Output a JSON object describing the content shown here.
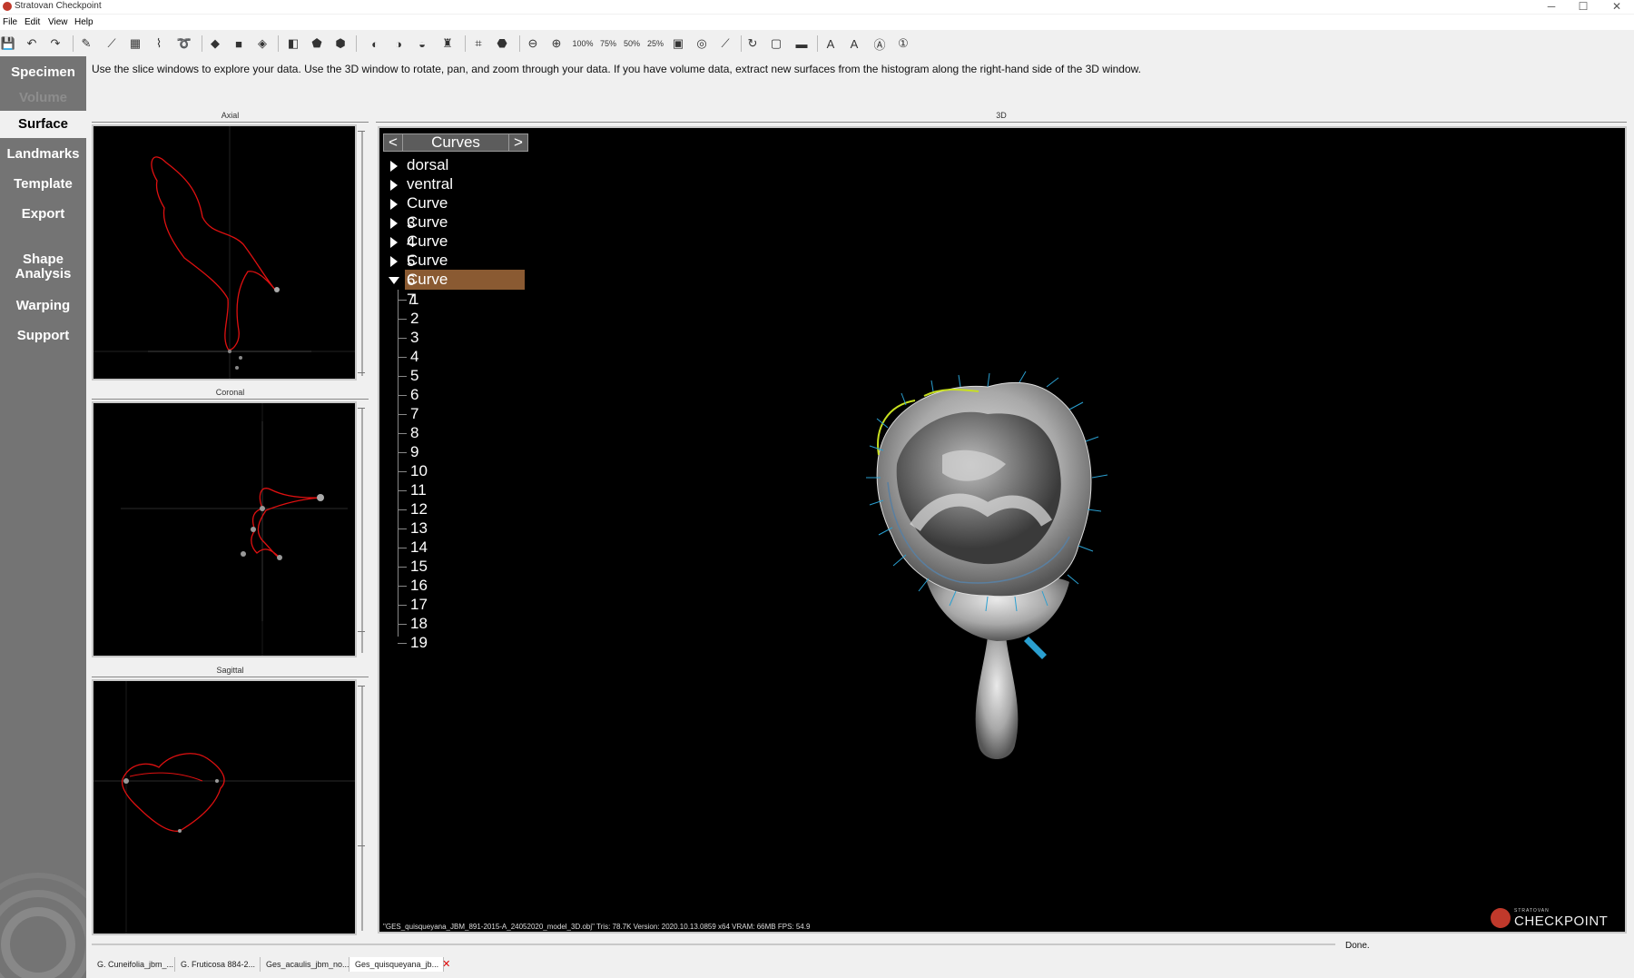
{
  "window": {
    "title": "Stratovan Checkpoint",
    "controls": [
      "─",
      "☐",
      "✕"
    ]
  },
  "menu": [
    "File",
    "Edit",
    "View",
    "Help"
  ],
  "toolbar": {
    "zoom_levels": [
      "100%",
      "75%",
      "50%",
      "25%"
    ]
  },
  "sidebar": {
    "items": [
      {
        "label": "Specimen",
        "state": "normal"
      },
      {
        "label": "Volume",
        "state": "disabled"
      },
      {
        "label": "Surface",
        "state": "active"
      },
      {
        "label": "Landmarks",
        "state": "normal"
      },
      {
        "label": "Template",
        "state": "normal"
      },
      {
        "label": "Export",
        "state": "normal"
      },
      {
        "label": "Shape\nAnalysis",
        "state": "normal"
      },
      {
        "label": "Warping",
        "state": "normal"
      },
      {
        "label": "Support",
        "state": "normal"
      }
    ]
  },
  "instruction": "Use the slice windows to explore your data. Use the 3D window to rotate, pan, and zoom through your data. If you have volume data, extract new surfaces from the histogram along the right-hand side of the 3D window.",
  "slices": {
    "axial": "Axial",
    "coronal": "Coronal",
    "sagittal": "Sagittal"
  },
  "view3d": {
    "title": "3D",
    "curves_header": "Curves",
    "prev": "<",
    "next": ">",
    "curves": [
      "dorsal",
      "ventral",
      "Curve 3",
      "Curve 4",
      "Curve 5",
      "Curve 6",
      "Curve 7"
    ],
    "expanded_curve": "Curve 7",
    "points": [
      "1",
      "2",
      "3",
      "4",
      "5",
      "6",
      "7",
      "8",
      "9",
      "10",
      "11",
      "12",
      "13",
      "14",
      "15",
      "16",
      "17",
      "18",
      "19"
    ],
    "status": "\"GES_quisqueyana_JBM_891-2015-A_24052020_model_3D.obj\" Tris: 78.7K Version: 2020.10.13.0859 x64  VRAM: 66MB  FPS: 54.9",
    "logo_top": "STRATOVAN",
    "logo": "CHECKPOINT"
  },
  "status_done": "Done.",
  "file_tabs": [
    {
      "label": "G. Cuneifolia_jbm_...",
      "active": false
    },
    {
      "label": "G. Fruticosa 884-2...",
      "active": false
    },
    {
      "label": "Ges_acaulis_jbm_no...",
      "active": false
    },
    {
      "label": "Ges_quisqueyana_jb...",
      "active": true
    }
  ],
  "colors": {
    "sidebar": "#747474",
    "selection": "#8a5a32",
    "curve": "#e01010",
    "accent_curve": "#c8e020"
  }
}
